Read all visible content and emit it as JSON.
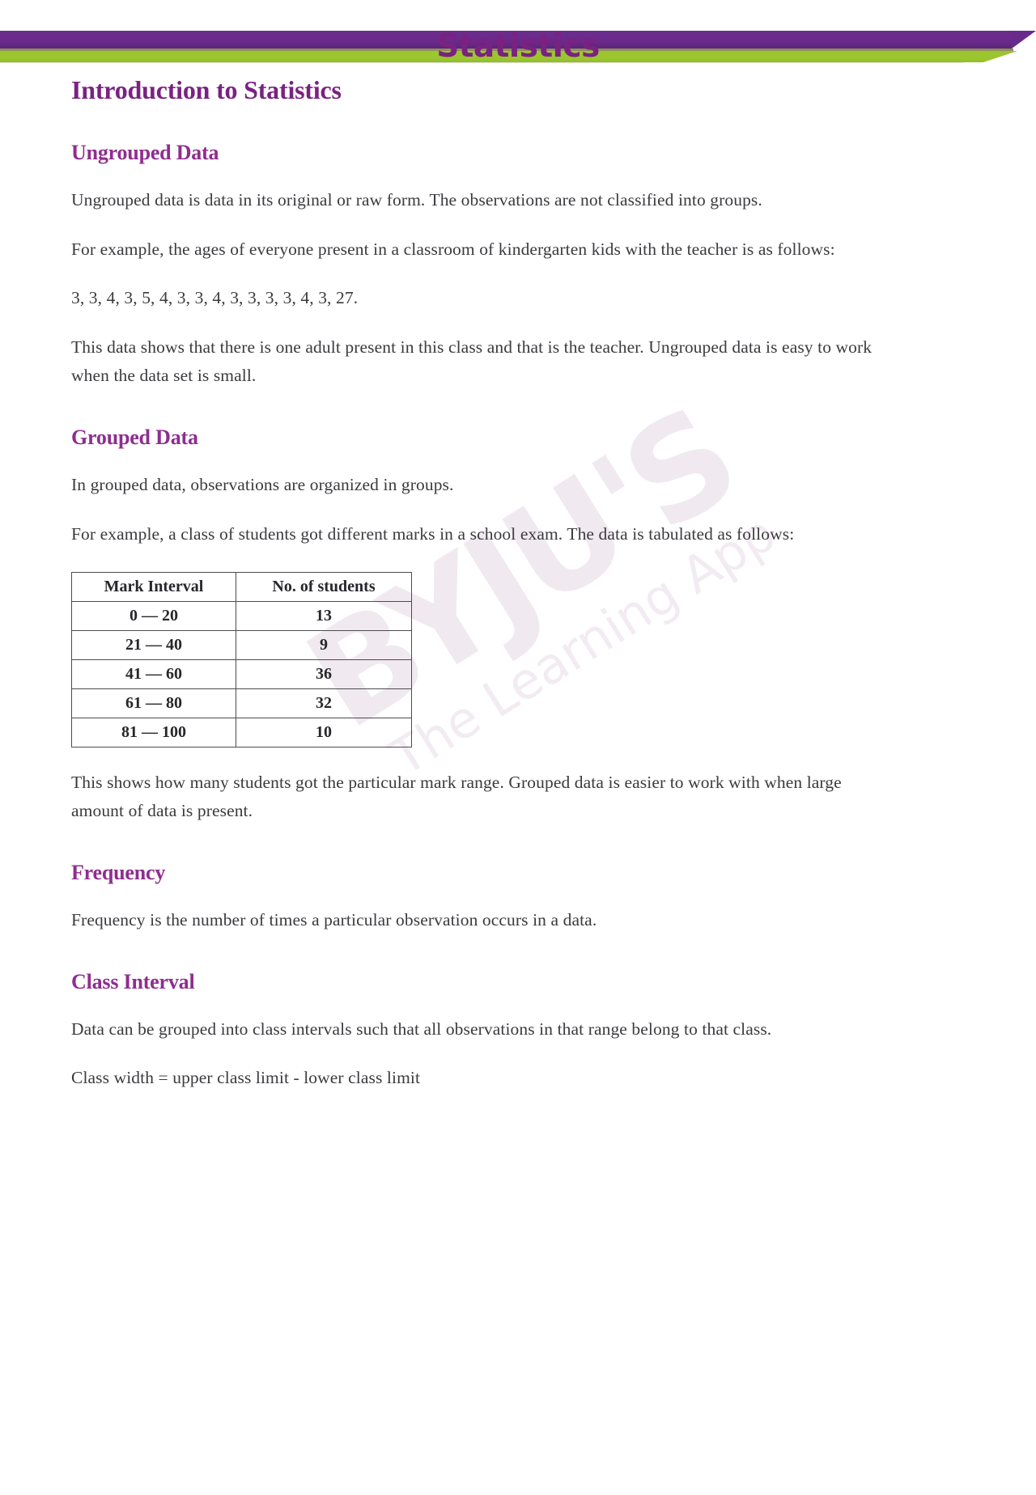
{
  "document": {
    "title": "Statistics",
    "heading": "Introduction to Statistics"
  },
  "watermark": {
    "brand": "BYJU'S",
    "tagline": "The Learning App"
  },
  "sections": [
    {
      "heading": "Ungrouped Data",
      "paragraphs": [
        "Ungrouped data is data in its original or raw form. The observations are not classified into groups.",
        "For example, the ages of everyone present in a classroom of kindergarten kids with the teacher is as follows:",
        "3, 3, 4, 3, 5, 4, 3, 3, 4, 3, 3, 3, 3, 4, 3, 27.",
        "This data shows that there is one adult present in this class and that is the teacher. Ungrouped data is easy to work when the data set is small."
      ]
    },
    {
      "heading": "Grouped Data",
      "paragraphs": [
        "In grouped data, observations are organized in groups.",
        "For example, a class of students got different marks in a school exam. The data is tabulated as follows:",
        "This shows how many students got the particular mark range. Grouped data is easier to work with when large amount of data is present."
      ]
    },
    {
      "heading": "Frequency",
      "paragraphs": [
        "Frequency is the number of times a particular observation occurs in a data."
      ]
    },
    {
      "heading": "Class Interval",
      "paragraphs": [
        "Data can be grouped into class intervals such that all observations in that range belong to that class.",
        "Class width = upper class limit - lower class limit"
      ]
    }
  ],
  "marks_table": {
    "headers": [
      "Mark Interval",
      "No. of students"
    ],
    "rows": [
      [
        "0 — 20",
        "13"
      ],
      [
        "21 — 40",
        "9"
      ],
      [
        "41 — 60",
        "36"
      ],
      [
        "61 — 80",
        "32"
      ],
      [
        "81 — 100",
        "10"
      ]
    ]
  },
  "colors": {
    "title_purple": "#7a2282",
    "heading_purple": "#8f2d8f",
    "banner_purple": "#6a2a8c",
    "banner_green": "#9bc52e",
    "body_text": "#3b3b3f"
  }
}
